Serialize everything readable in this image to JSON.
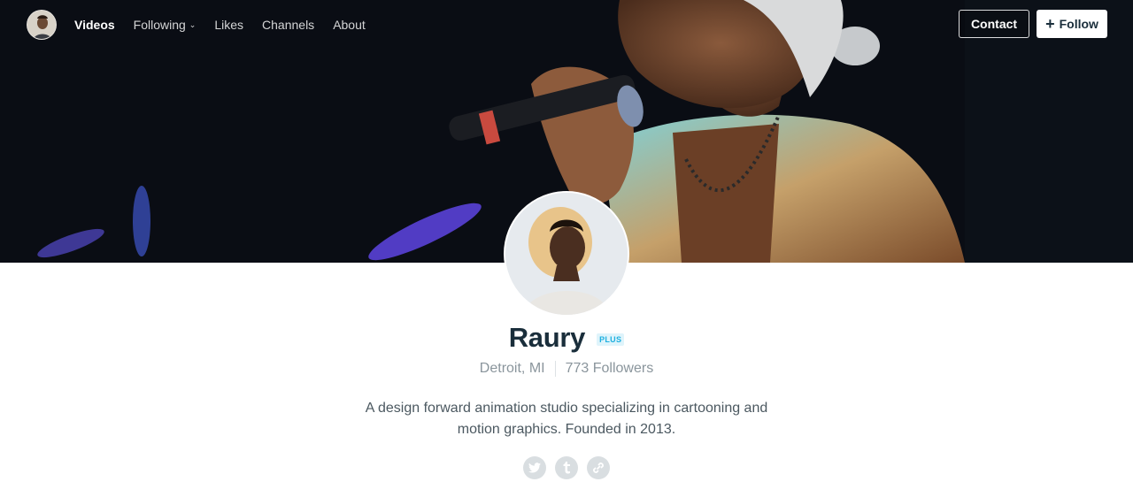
{
  "nav": {
    "links": [
      {
        "label": "Videos",
        "active": true
      },
      {
        "label": "Following",
        "has_dropdown": true
      },
      {
        "label": "Likes"
      },
      {
        "label": "Channels"
      },
      {
        "label": "About"
      }
    ],
    "dropdown_chevron": "⌄",
    "contact_label": "Contact",
    "follow_label": "Follow",
    "follow_icon": "+"
  },
  "profile": {
    "name": "Raury",
    "badge": "PLUS",
    "location": "Detroit, MI",
    "followers": "773 Followers",
    "bio": "A design forward animation studio specializing in cartooning and motion graphics. Founded in 2013."
  },
  "social_icons": [
    "twitter-icon",
    "tumblr-icon",
    "link-icon"
  ],
  "colors": {
    "badge_bg": "#dff4fb",
    "badge_text": "#1fb0e0",
    "text_dark": "#1a2e3b",
    "muted": "#8a959c"
  }
}
